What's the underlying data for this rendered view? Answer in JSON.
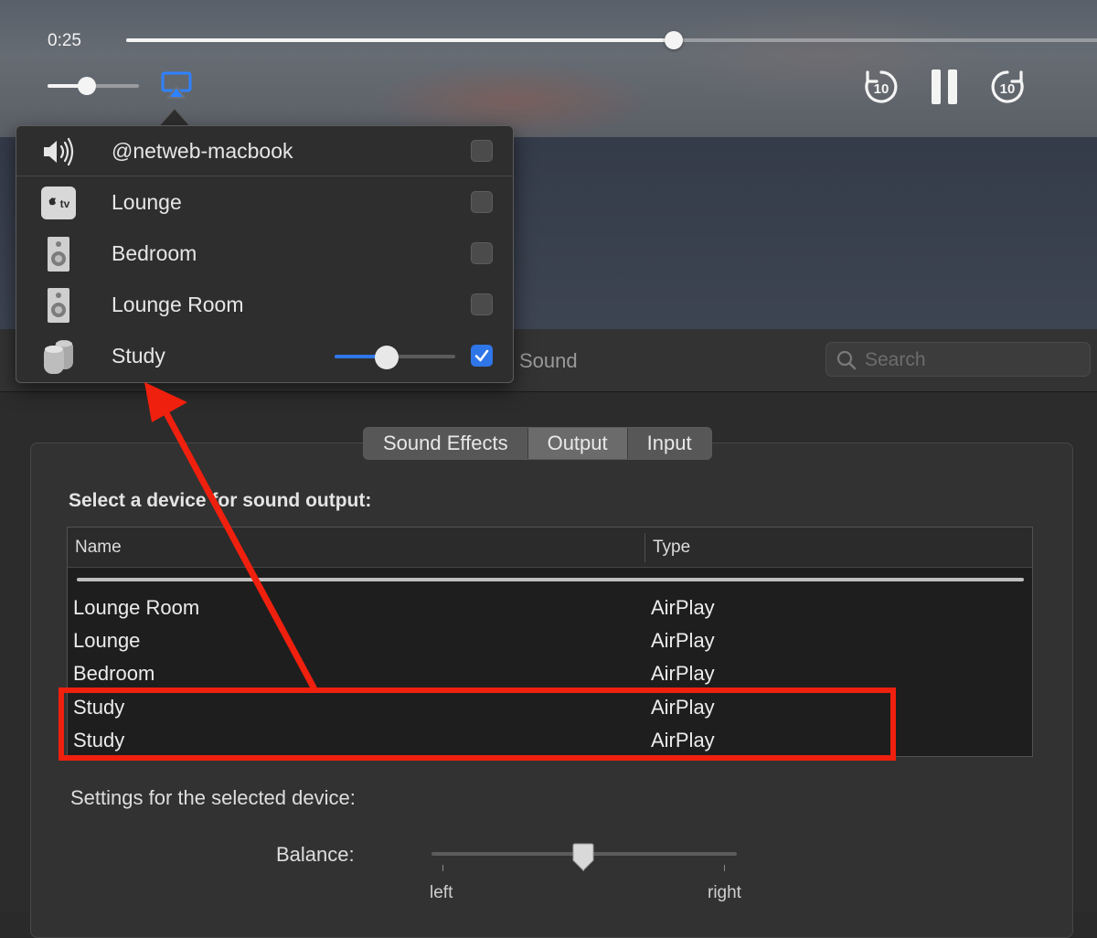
{
  "player": {
    "elapsed": "0:25",
    "progress": 0.56,
    "volume": 0.43,
    "skip_back_seconds": "10",
    "skip_forward_seconds": "10"
  },
  "airplay_menu": {
    "current_device": {
      "label": "@netweb-macbook",
      "icon": "speaker-volume-icon",
      "checked": false
    },
    "devices": [
      {
        "label": "Lounge",
        "icon": "apple-tv-icon",
        "checked": false
      },
      {
        "label": "Bedroom",
        "icon": "speaker-icon",
        "checked": false
      },
      {
        "label": "Lounge Room",
        "icon": "speaker-icon",
        "checked": false
      },
      {
        "label": "Study",
        "icon": "homepod-icon",
        "checked": true,
        "volume": 0.43
      }
    ]
  },
  "preferences": {
    "title": "Sound",
    "search_placeholder": "Search",
    "tabs": [
      "Sound Effects",
      "Output",
      "Input"
    ],
    "active_tab": "Output",
    "select_label": "Select a device for sound output:",
    "columns": [
      "Name",
      "Type"
    ],
    "rows": [
      {
        "name": "Lounge Room",
        "type": "AirPlay"
      },
      {
        "name": "Lounge",
        "type": "AirPlay"
      },
      {
        "name": "Bedroom",
        "type": "AirPlay"
      },
      {
        "name": "Study",
        "type": "AirPlay"
      },
      {
        "name": "Study",
        "type": "AirPlay"
      }
    ],
    "settings_label": "Settings for the selected device:",
    "balance": {
      "label": "Balance:",
      "left": "left",
      "right": "right",
      "value": 0.5
    }
  },
  "annotation": {
    "color": "#f0200e"
  },
  "colors": {
    "accent": "#2f76e8"
  }
}
